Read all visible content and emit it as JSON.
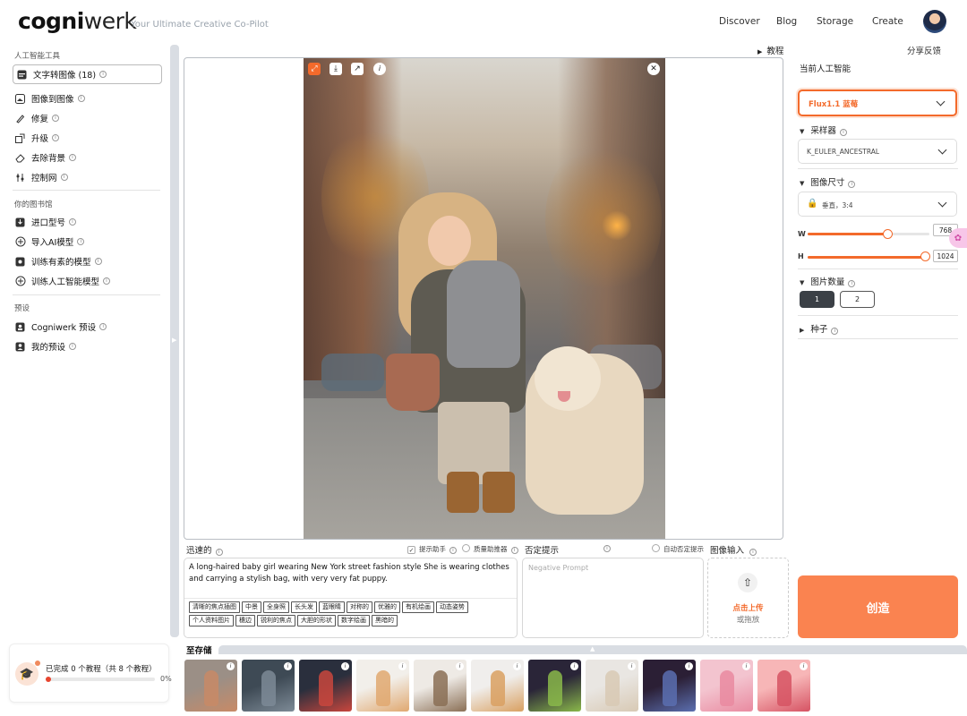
{
  "header": {
    "logo_bold": "cogni",
    "logo_light": "werk",
    "tagline": "Your Ultimate Creative Co-Pilot",
    "nav": [
      "Discover",
      "Blog",
      "Storage",
      "Create"
    ]
  },
  "sidebar": {
    "ai_tools_title": "人工智能工具",
    "ai_tools": [
      {
        "label": "文字转图像 (18)",
        "icon": "text-to-image-icon"
      },
      {
        "label": "图像到图像",
        "icon": "image-icon"
      },
      {
        "label": "修复",
        "icon": "brush-icon"
      },
      {
        "label": "升级",
        "icon": "upscale-icon"
      },
      {
        "label": "去除背景",
        "icon": "eraser-icon"
      },
      {
        "label": "控制网",
        "icon": "controlnet-icon"
      }
    ],
    "library_title": "你的图书馆",
    "library": [
      {
        "label": "进口型号",
        "icon": "import-model-icon"
      },
      {
        "label": "导入AI模型",
        "icon": "plus-circle-icon"
      },
      {
        "label": "训练有素的模型",
        "icon": "trained-model-icon"
      },
      {
        "label": "训练人工智能模型",
        "icon": "plus-circle-icon"
      }
    ],
    "presets_title": "预设",
    "presets": [
      {
        "label": "Cogniwerk 预设",
        "icon": "preset-icon"
      },
      {
        "label": "我的预设",
        "icon": "user-preset-icon"
      }
    ],
    "tutorial_progress_text": "已完成 0 个教程（共 8 个教程）",
    "tutorial_progress_pct": "0%",
    "tutorial_progress_value": 0
  },
  "canvas": {
    "tutorial_link": "教程"
  },
  "prompt": {
    "label": "迅速的",
    "assistant_label": "提示助手",
    "assistant_checked": true,
    "quality_label": "质量助推器",
    "quality_checked": false,
    "text": "A long-haired baby girl wearing New York street fashion style She is wearing clothes and carrying a stylish bag, with very very fat puppy.",
    "tags": [
      "清晰的焦点插图",
      "中景",
      "全身照",
      "长头发",
      "蓝眼睛",
      "对称的",
      "优雅的",
      "有机绘画",
      "动态姿势",
      "个人资料图片",
      "穗边",
      "锐利的焦点",
      "大胆的形状",
      "数字绘画",
      "黑暗的"
    ]
  },
  "negative": {
    "label": "否定提示",
    "auto_label": "自动否定提示",
    "placeholder": "Negative Prompt"
  },
  "image_input": {
    "label": "图像输入",
    "cta": "点击上传",
    "sub": "或拖放"
  },
  "storage": {
    "label": "至存储",
    "thumbs": [
      {
        "bg": "#9b8f86",
        "accent": "#c88a66"
      },
      {
        "bg": "#3e4a55",
        "accent": "#7d8a96"
      },
      {
        "bg": "#2a2f3d",
        "accent": "#c9463d"
      },
      {
        "bg": "#f2efea",
        "accent": "#e0a870"
      },
      {
        "bg": "#eeeae5",
        "accent": "#8a6f55"
      },
      {
        "bg": "#f0eeec",
        "accent": "#d9a061"
      },
      {
        "bg": "#2a2538",
        "accent": "#8ab84a"
      },
      {
        "bg": "#e9e6e2",
        "accent": "#d8c9b4"
      },
      {
        "bg": "#2b1f35",
        "accent": "#5b6fb0"
      },
      {
        "bg": "#f3c4cf",
        "accent": "#e98aa0"
      },
      {
        "bg": "#f7b6b7",
        "accent": "#d65363"
      }
    ]
  },
  "right": {
    "feedback": "分享反馈",
    "model_label": "当前人工智能",
    "model_value": "Flux1.1 蓝莓",
    "sampler_title": "采样器",
    "sampler_value": "K_EULER_ANCESTRAL",
    "size_title": "图像尺寸",
    "size_value": "垂直，3:4",
    "w_label": "W",
    "w_value": "768",
    "h_label": "H",
    "h_value": "1024",
    "count_title": "图片数量",
    "count_options": [
      "1",
      "2"
    ],
    "count_selected": "1",
    "seed_title": "种子",
    "create": "创造",
    "accent": "#f36a2b"
  }
}
